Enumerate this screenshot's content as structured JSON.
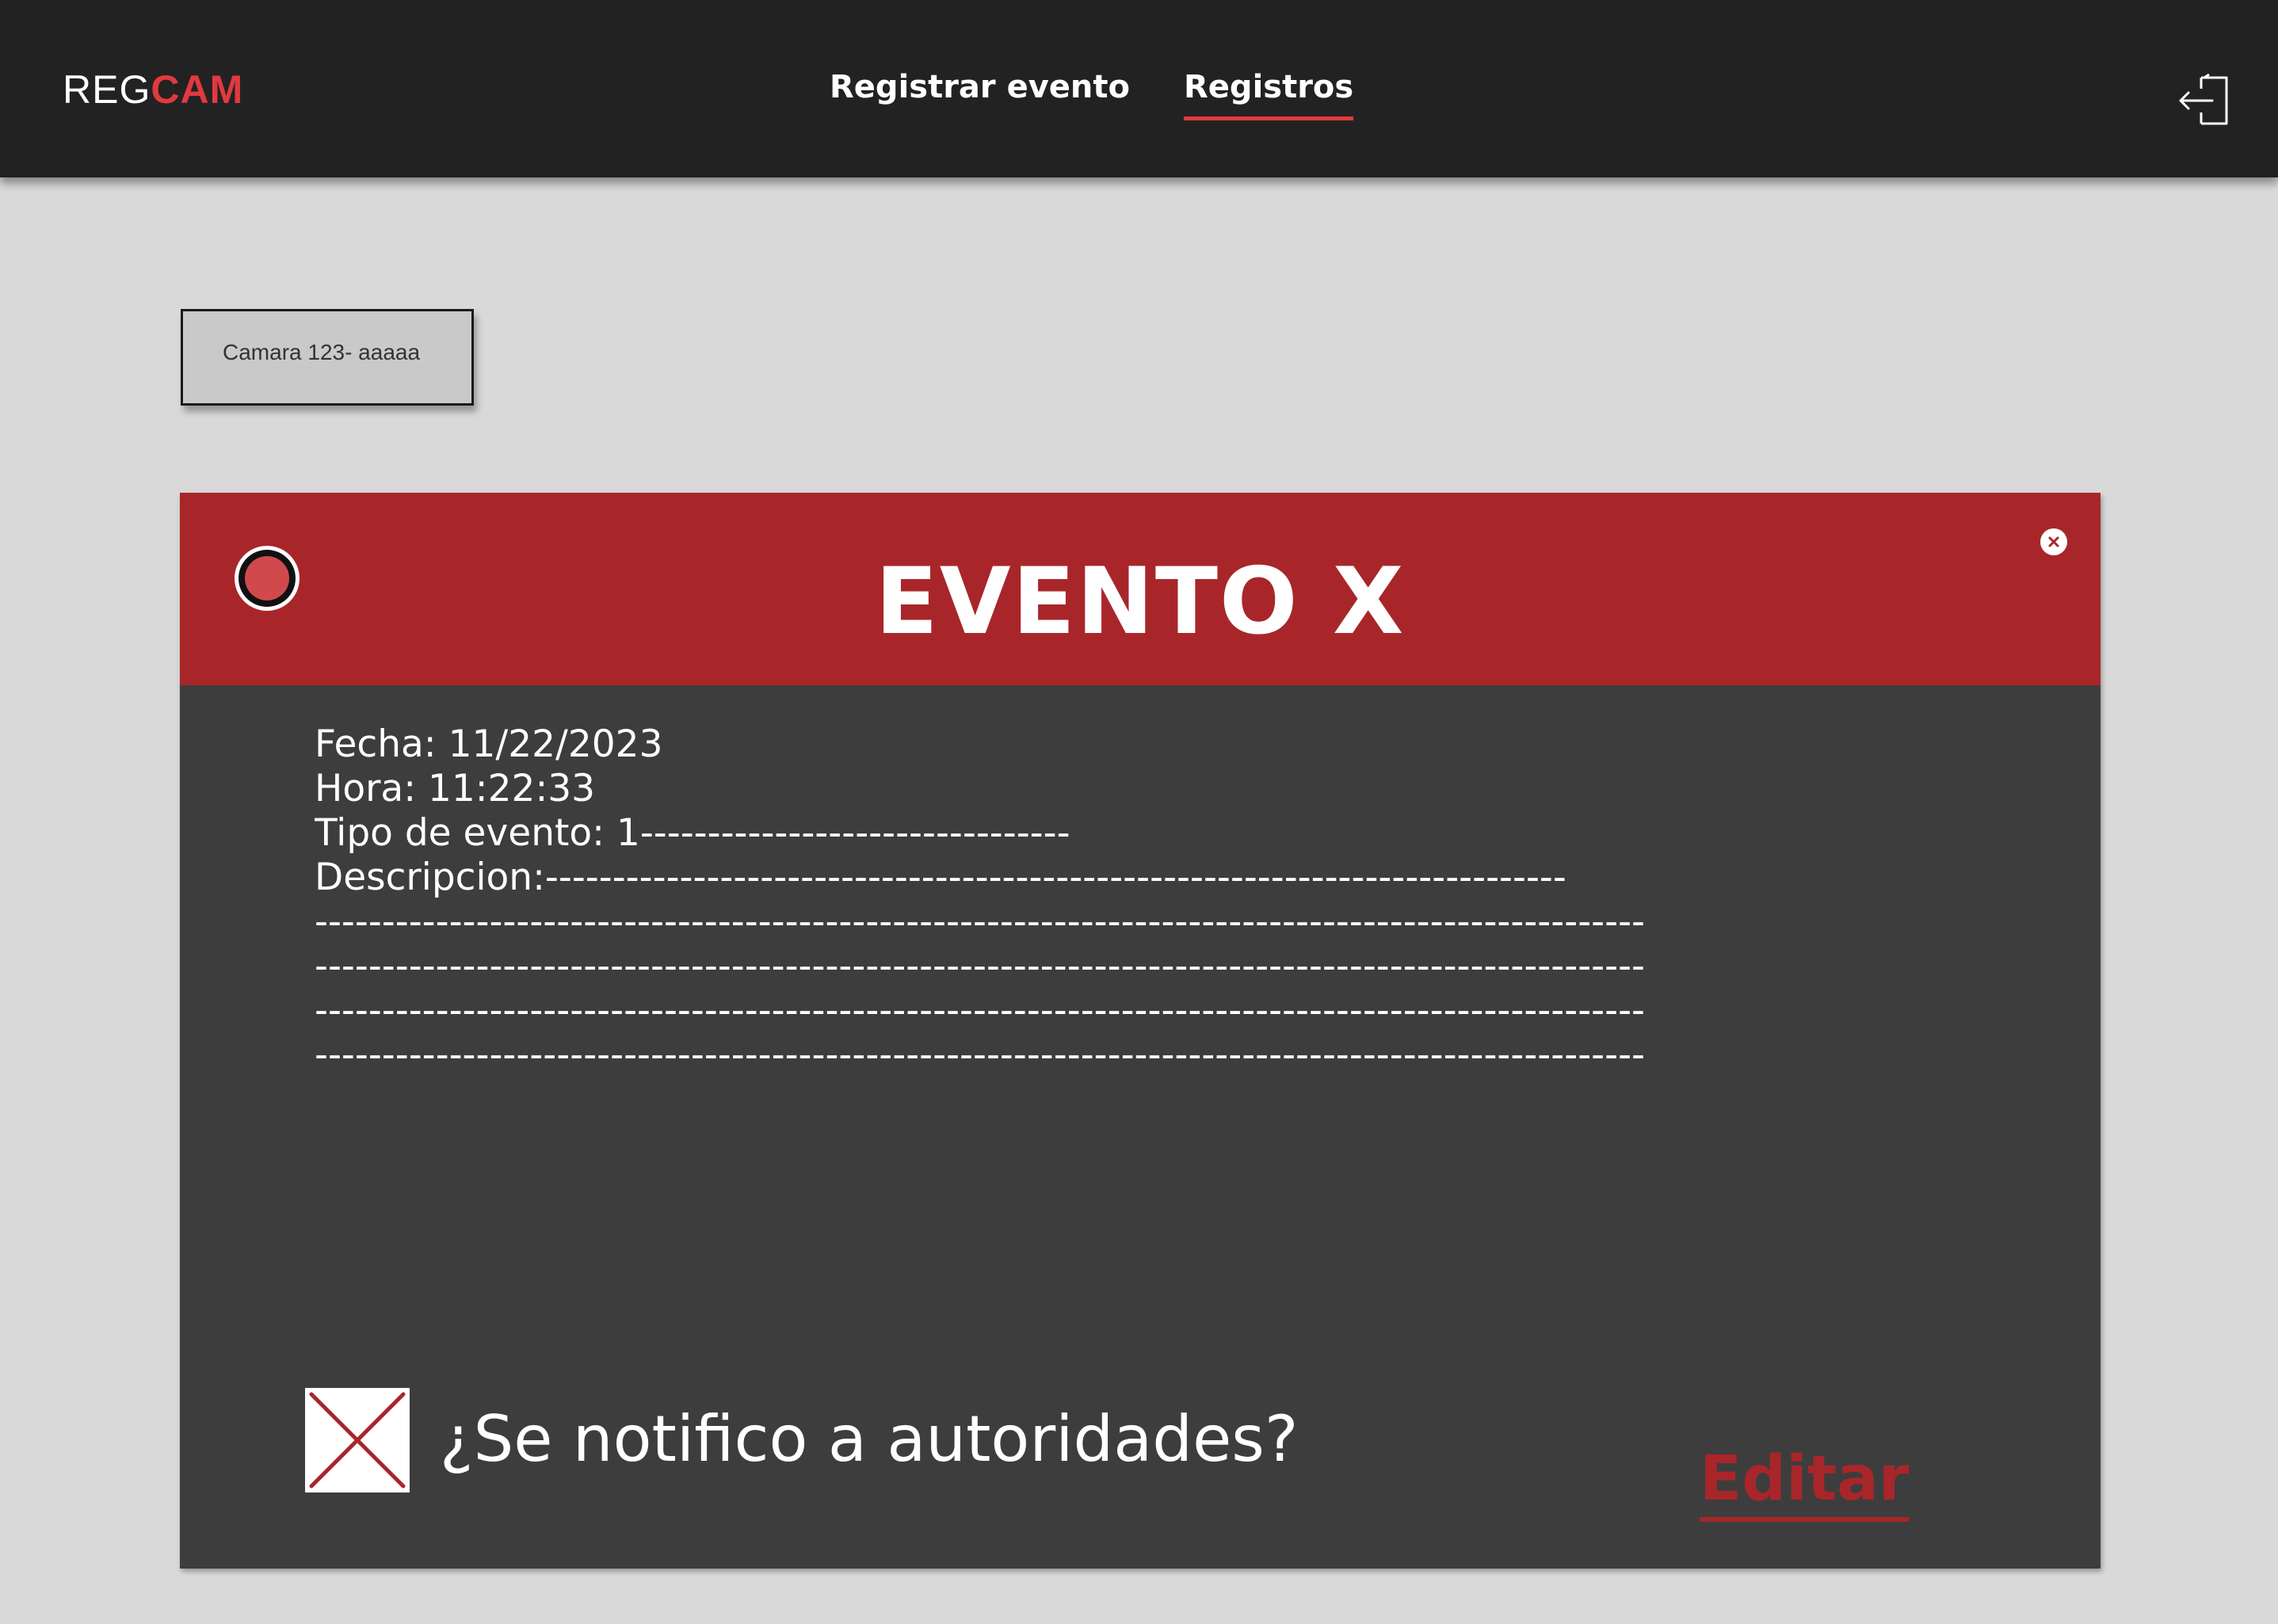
{
  "header": {
    "brand_prefix": "REG",
    "brand_suffix": "CAM",
    "nav": {
      "register_event": "Registrar evento",
      "records": "Registros"
    },
    "logout_icon": "logout-icon"
  },
  "camera_selector": {
    "label": "Camara 123- aaaaa"
  },
  "event": {
    "title": "EVENTO X",
    "status_icon": "record-status-icon",
    "close_icon": "close-icon",
    "date_line": "Fecha: 11/22/2023",
    "time_line": "Hora: 11:22:33",
    "type_line": "Tipo de evento: 1--------------------------------",
    "description_line": "Descripcion:----------------------------------------------------------------------------",
    "description_cont": [
      "---------------------------------------------------------------------------------------------------",
      "---------------------------------------------------------------------------------------------------",
      "---------------------------------------------------------------------------------------------------",
      "---------------------------------------------------------------------------------------------------"
    ],
    "notified_question": "¿Se notifico a autoridades?",
    "notified_checked": false,
    "edit_label": "Editar"
  },
  "colors": {
    "topbar": "#232222",
    "accent": "#e03a3e",
    "event_header": "#a8262a",
    "card_body": "#3d3d3d",
    "page_bg": "#d9d9d9"
  }
}
